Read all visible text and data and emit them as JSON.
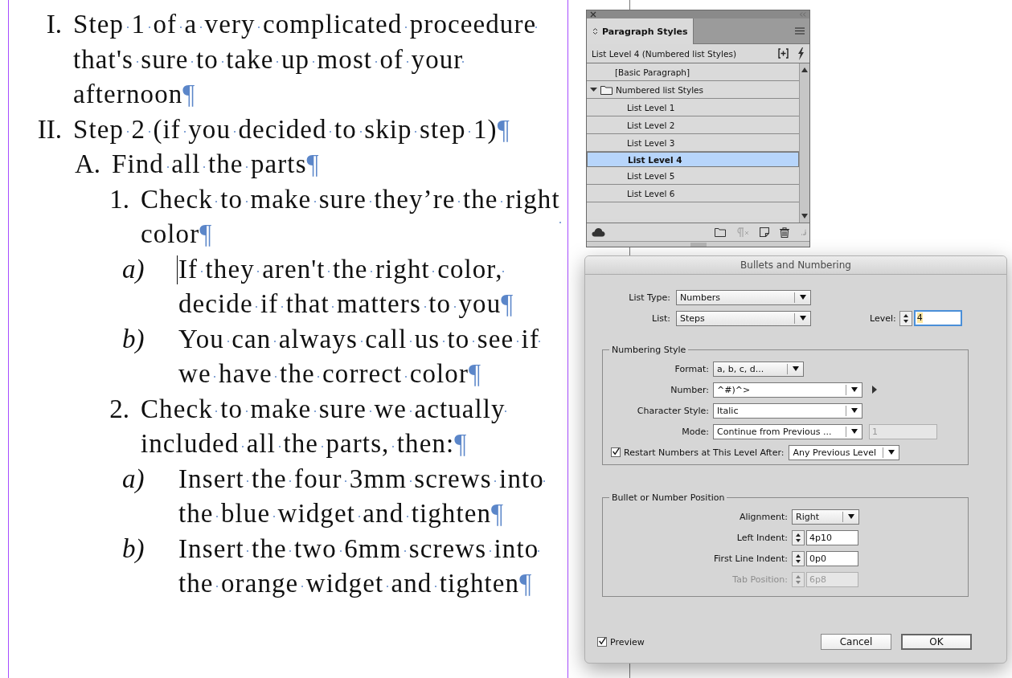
{
  "document": {
    "show_hidden_characters": true,
    "items": [
      {
        "marker": "I.",
        "text": "Step 1 of a very complicated proceedure that's sure to take up most of your afternoon",
        "end_mark": "¶",
        "cursor": false
      },
      {
        "marker": "II.",
        "text": "Step 2 (if you decided to skip step 1)",
        "end_mark": "¶",
        "cursor": false,
        "children": [
          {
            "marker": "A.",
            "text": "Find all the parts",
            "end_mark": "¶",
            "cursor": false,
            "children": [
              {
                "marker": "1.",
                "text": "Check to make sure they’re the right color",
                "end_mark": "¶",
                "cursor": false,
                "children": [
                  {
                    "marker": "a)",
                    "text": "If they aren't the right color, decide if that matters to you",
                    "end_mark": "¶",
                    "cursor": true
                  },
                  {
                    "marker": "b)",
                    "text": "You can always call us to see if we have the correct color",
                    "end_mark": "¶",
                    "cursor": false
                  }
                ]
              },
              {
                "marker": "2.",
                "text": "Check to make sure we actually included all the parts, then:",
                "end_mark": "¶",
                "cursor": false,
                "children": [
                  {
                    "marker": "a)",
                    "text": "Insert the four 3mm screws into the blue widget and tighten",
                    "end_mark": "¶",
                    "cursor": false
                  },
                  {
                    "marker": "b)",
                    "text": "Insert the two 6mm screws into the orange widget and tighten",
                    "end_mark": "¶",
                    "cursor": false
                  }
                ]
              }
            ]
          }
        ]
      }
    ]
  },
  "panel": {
    "tab": "Paragraph Styles",
    "current_style": "List Level 4 (Numbered list Styles)",
    "styles": [
      {
        "kind": "style",
        "label": "[Basic Paragraph]",
        "selected": false
      },
      {
        "kind": "group",
        "label": "Numbered list Styles",
        "selected": false,
        "expanded": true,
        "children": [
          {
            "kind": "style",
            "label": "List Level 1",
            "selected": false
          },
          {
            "kind": "style",
            "label": "List Level 2",
            "selected": false
          },
          {
            "kind": "style",
            "label": "List Level 3",
            "selected": false
          },
          {
            "kind": "style",
            "label": "List Level 4",
            "selected": true
          },
          {
            "kind": "style",
            "label": "List Level 5",
            "selected": false
          },
          {
            "kind": "style",
            "label": "List Level 6",
            "selected": false
          }
        ]
      }
    ]
  },
  "dialog": {
    "title": "Bullets and Numbering",
    "list_type": {
      "label": "List Type:",
      "value": "Numbers"
    },
    "list": {
      "label": "List:",
      "value": "Steps"
    },
    "level": {
      "label": "Level:",
      "value": "4"
    },
    "numbering_style": {
      "legend": "Numbering Style",
      "fields": [
        {
          "kind": "select",
          "label": "Format:",
          "value": "a, b, c, d...",
          "has_flyout": false
        },
        {
          "kind": "combo",
          "label": "Number:",
          "value": "^#)^>",
          "has_flyout": true
        },
        {
          "kind": "combo",
          "label": "Character Style:",
          "value": "Italic",
          "has_flyout": false
        },
        {
          "kind": "combo",
          "label": "Mode:",
          "value": "Continue from Previous ...",
          "has_flyout": false,
          "extra": {
            "value": "1",
            "disabled": true
          }
        }
      ],
      "restart": {
        "label": "Restart Numbers at This Level After:",
        "checked": true,
        "value": "Any Previous Level"
      }
    },
    "position": {
      "legend": "Bullet or Number Position",
      "fields": [
        {
          "kind": "select",
          "label": "Alignment:",
          "value": "Right",
          "disabled": false
        },
        {
          "kind": "spinner",
          "label": "Left Indent:",
          "value": "4p10",
          "disabled": false
        },
        {
          "kind": "spinner",
          "label": "First Line Indent:",
          "value": "0p0",
          "disabled": false
        },
        {
          "kind": "spinner",
          "label": "Tab Position:",
          "value": "6p8",
          "disabled": true
        }
      ]
    },
    "preview": {
      "label": "Preview",
      "checked": true
    },
    "buttons": [
      {
        "label": "Cancel",
        "default": false
      },
      {
        "label": "OK",
        "default": true
      }
    ]
  }
}
